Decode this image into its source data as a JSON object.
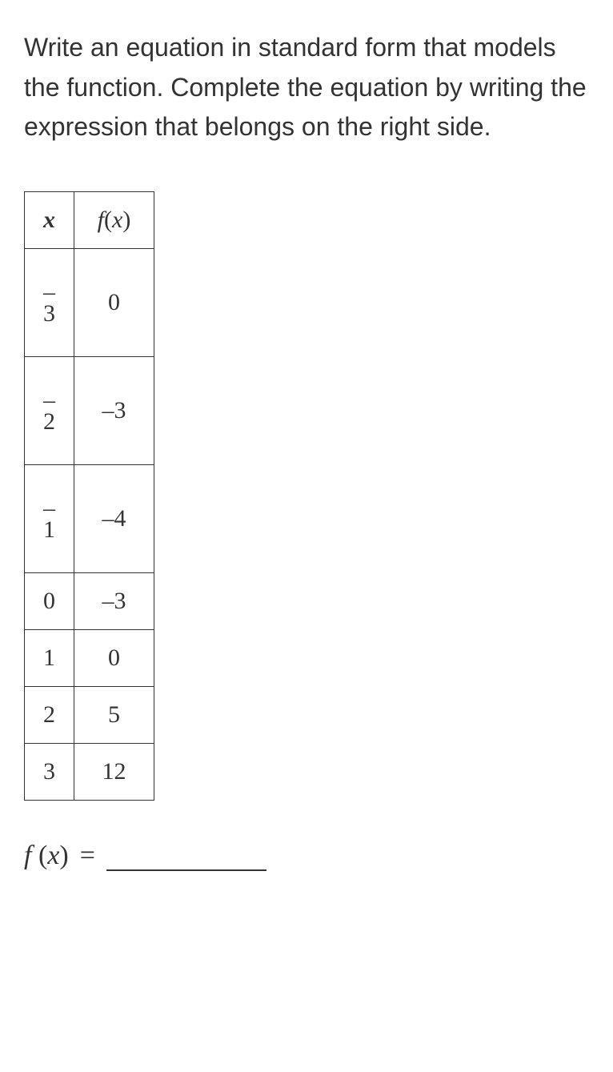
{
  "prompt": "Write an equation in standard form that models the function. Complete the equation by writing the expression that belongs on the right side.",
  "table": {
    "headers": {
      "x": "x",
      "fx_f": "f",
      "fx_open": "(",
      "fx_x": "x",
      "fx_close": ")"
    },
    "rows": [
      {
        "x_minus": "–",
        "x_num": "3",
        "fx": "0"
      },
      {
        "x_minus": "–",
        "x_num": "2",
        "fx": "–3"
      },
      {
        "x_minus": "–",
        "x_num": "1",
        "fx": "–4"
      },
      {
        "x": "0",
        "fx": "–3"
      },
      {
        "x": "1",
        "fx": "0"
      },
      {
        "x": "2",
        "fx": "5"
      },
      {
        "x": "3",
        "fx": "12"
      }
    ]
  },
  "equation": {
    "f": "f",
    "space_open": " (",
    "x": "x",
    "close": ")",
    "equals": "="
  }
}
